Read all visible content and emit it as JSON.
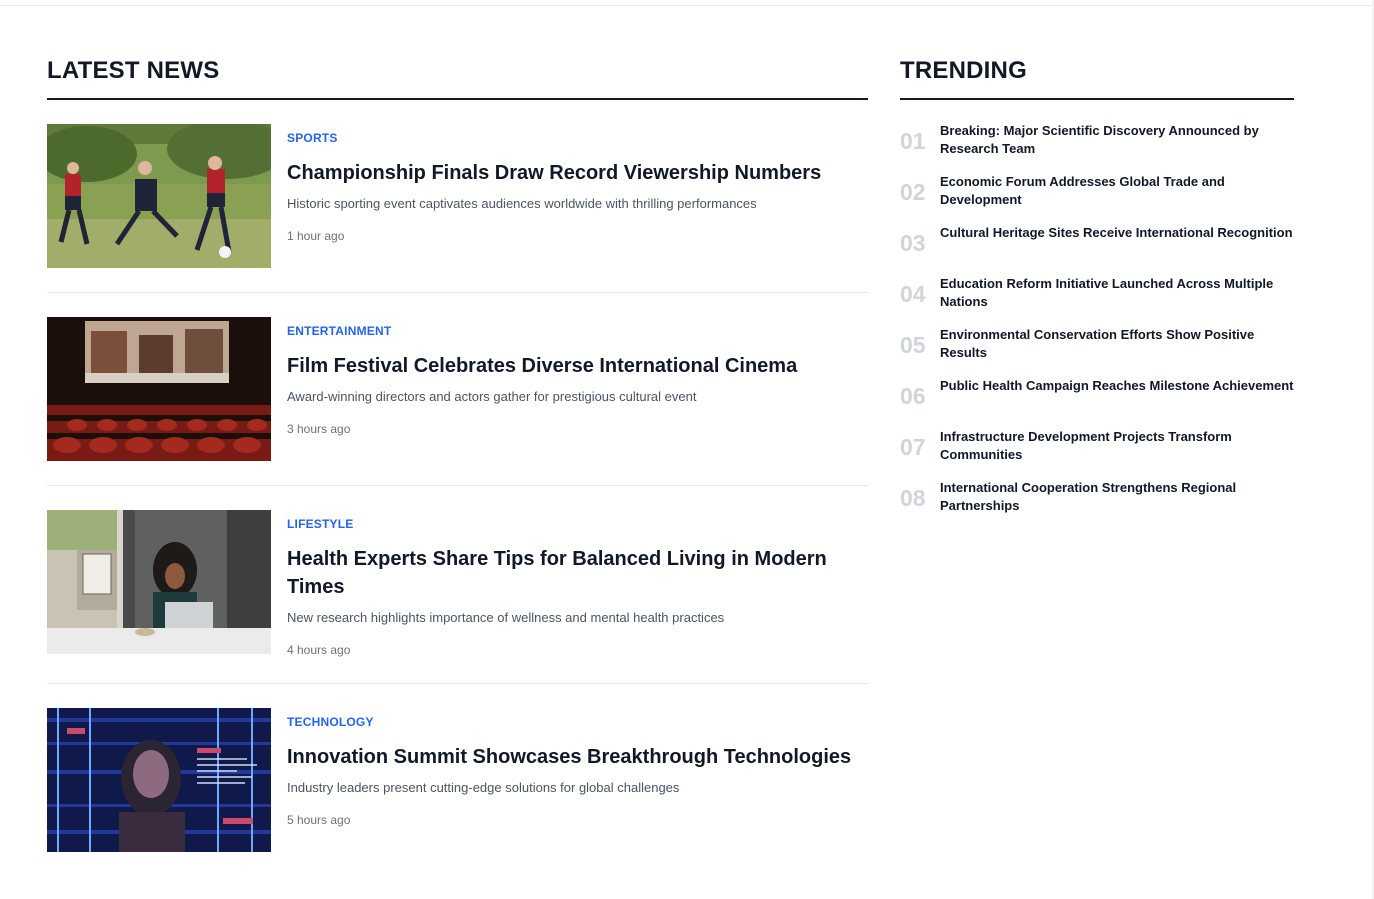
{
  "latest": {
    "title": "LATEST NEWS",
    "articles": [
      {
        "category": "SPORTS",
        "headline": "Championship Finals Draw Record Viewership Numbers",
        "summary": "Historic sporting event captivates audiences worldwide with thrilling performances",
        "time": "1 hour ago"
      },
      {
        "category": "ENTERTAINMENT",
        "headline": "Film Festival Celebrates Diverse International Cinema",
        "summary": "Award-winning directors and actors gather for prestigious cultural event",
        "time": "3 hours ago"
      },
      {
        "category": "LIFESTYLE",
        "headline": "Health Experts Share Tips for Balanced Living in Modern Times",
        "summary": "New research highlights importance of wellness and mental health practices",
        "time": "4 hours ago"
      },
      {
        "category": "TECHNOLOGY",
        "headline": "Innovation Summit Showcases Breakthrough Technologies",
        "summary": "Industry leaders present cutting-edge solutions for global challenges",
        "time": "5 hours ago"
      }
    ]
  },
  "trending": {
    "title": "TRENDING",
    "items": [
      {
        "num": "01",
        "text": "Breaking: Major Scientific Discovery Announced by Research Team"
      },
      {
        "num": "02",
        "text": "Economic Forum Addresses Global Trade and Development"
      },
      {
        "num": "03",
        "text": "Cultural Heritage Sites Receive International Recognition"
      },
      {
        "num": "04",
        "text": "Education Reform Initiative Launched Across Multiple Nations"
      },
      {
        "num": "05",
        "text": "Environmental Conservation Efforts Show Positive Results"
      },
      {
        "num": "06",
        "text": "Public Health Campaign Reaches Milestone Achievement"
      },
      {
        "num": "07",
        "text": "Infrastructure Development Projects Transform Communities"
      },
      {
        "num": "08",
        "text": "International Cooperation Strengthens Regional Partnerships"
      }
    ]
  },
  "colors": {
    "accent": "#2563eb",
    "heading": "#111827",
    "muted": "#6b7280",
    "trend_number": "#d1d5db"
  }
}
